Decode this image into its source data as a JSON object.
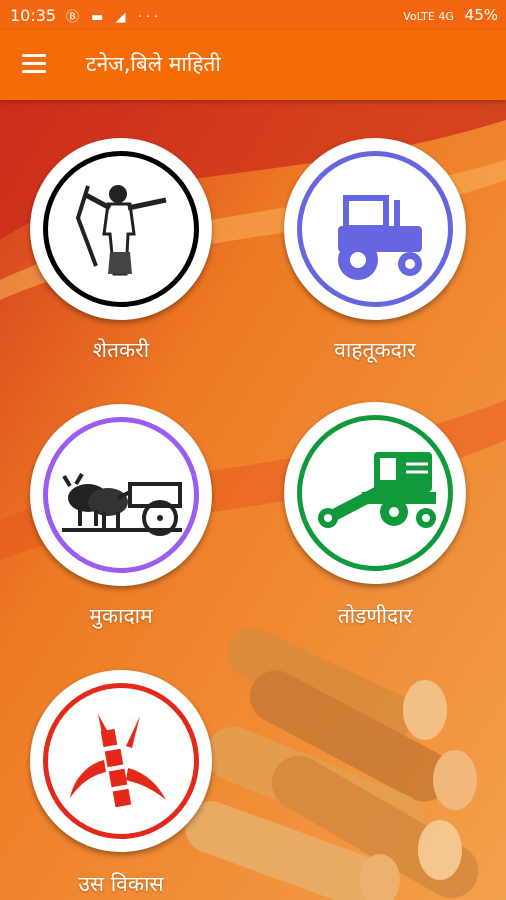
{
  "status_bar": {
    "time": "10:35",
    "notifications": "Ⓑ ▬ ◢ ···",
    "signal": "VoLTE 4G",
    "battery": "45%"
  },
  "app_bar": {
    "title": "टनेज,बिले माहिती"
  },
  "tiles": [
    {
      "label": "शेतकरी",
      "icon": "farmer-icon",
      "ring_color": "#000000"
    },
    {
      "label": "वाहतूकदार",
      "icon": "tractor-icon",
      "ring_color": "#6666e0"
    },
    {
      "label": "मुकादाम",
      "icon": "bullock-cart-icon",
      "ring_color": "#9b5cf0"
    },
    {
      "label": "तोडणीदार",
      "icon": "harvester-icon",
      "ring_color": "#109a3c"
    },
    {
      "label": "उस विकास",
      "icon": "sugarcane-icon",
      "ring_color": "#e4291a"
    }
  ]
}
